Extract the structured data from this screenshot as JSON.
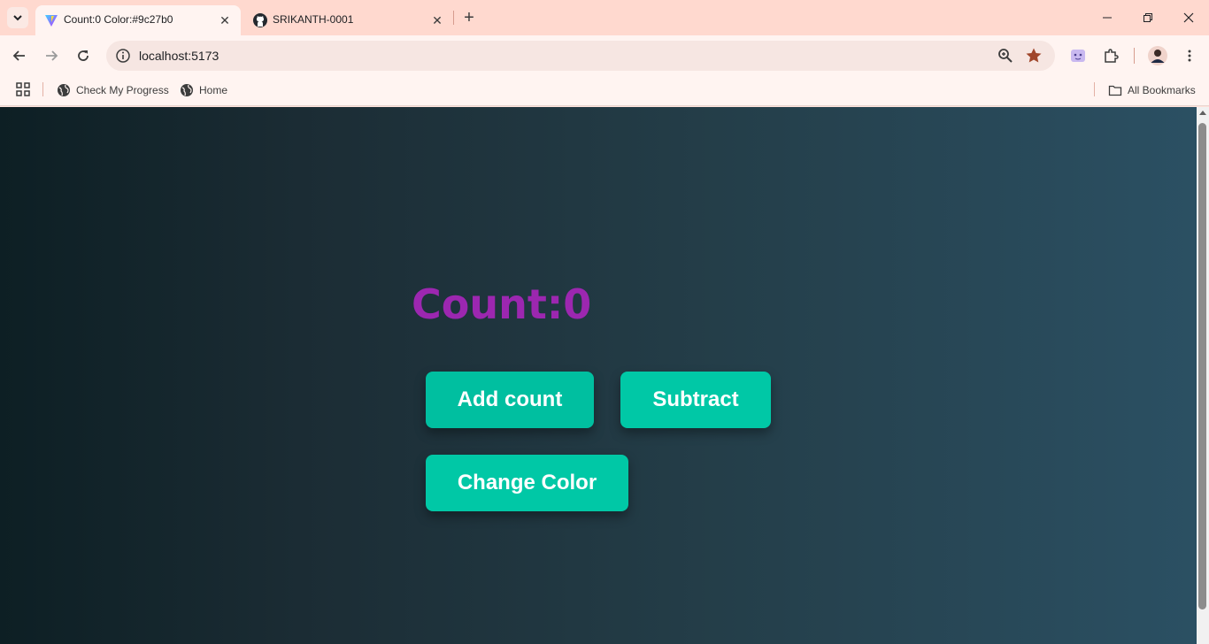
{
  "browser": {
    "tabs": [
      {
        "title": "Count:0 Color:#9c27b0",
        "active": true,
        "icon": "vite-icon"
      },
      {
        "title": "SRIKANTH-0001",
        "active": false,
        "icon": "github-icon"
      }
    ],
    "url": "localhost:5173",
    "bookmarks": [
      {
        "label": "Check My Progress",
        "icon": "globe-icon"
      },
      {
        "label": "Home",
        "icon": "globe-icon"
      }
    ],
    "all_bookmarks_label": "All Bookmarks"
  },
  "page": {
    "count_text": "Count:0",
    "count_color": "#9c27b0",
    "buttons": {
      "add": "Add count",
      "subtract": "Subtract",
      "change_color": "Change Color"
    },
    "button_color": "#00c8a6"
  }
}
